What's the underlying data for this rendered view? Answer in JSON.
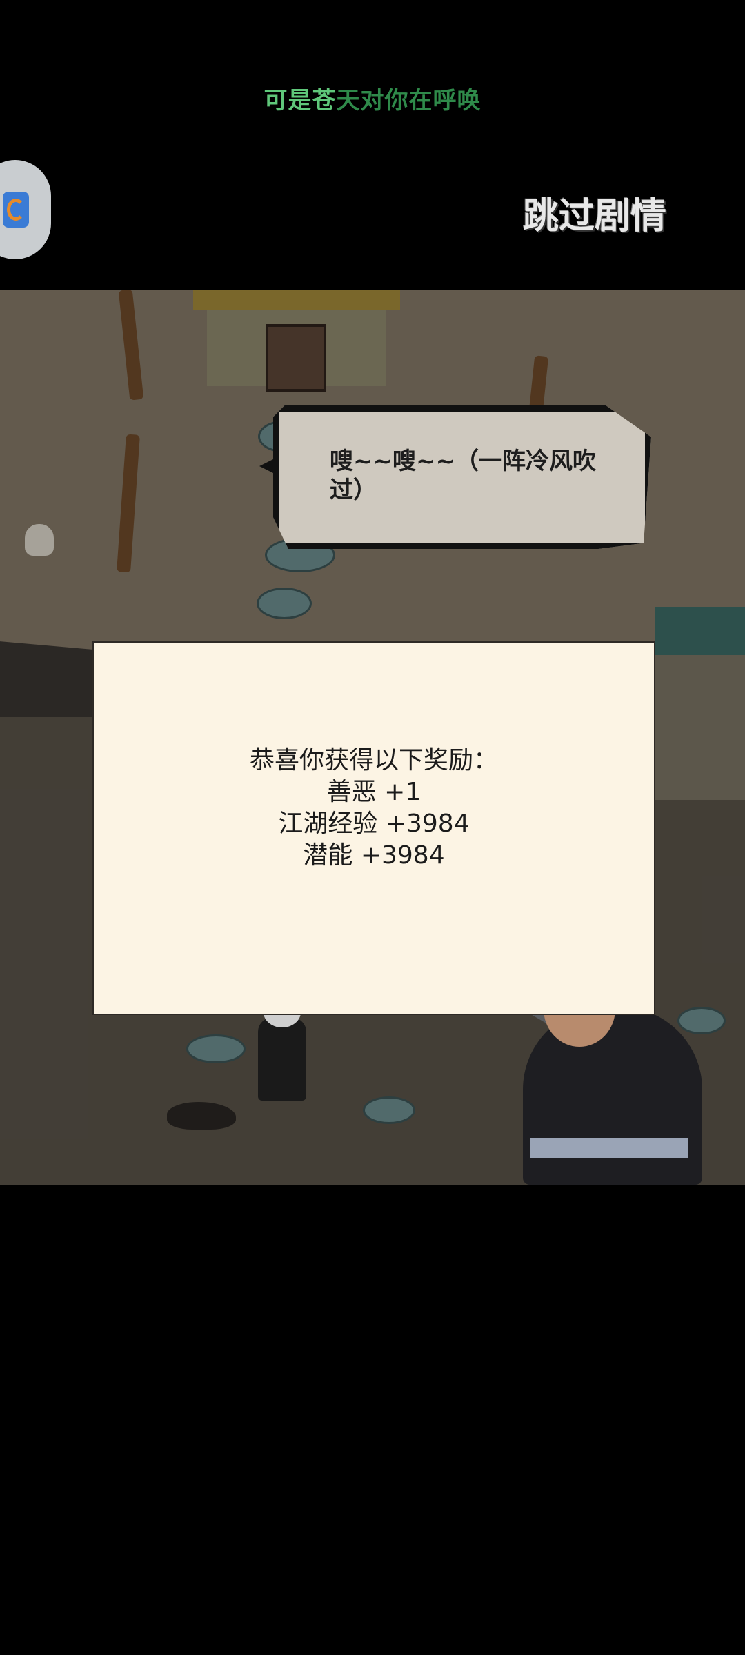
{
  "lyric": {
    "highlighted": "可是苍",
    "rest": "天对你在呼唤"
  },
  "skip_button": {
    "label": "跳过剧情"
  },
  "speech_bubble": {
    "text": "嗖~~嗖~~（一阵冷风吹过）"
  },
  "reward_dialog": {
    "title": "恭喜你获得以下奖励：",
    "items": [
      "善恶 +1",
      "江湖经验 +3984",
      "潜能 +3984"
    ]
  },
  "colors": {
    "lyric_highlight": "#5fc77a",
    "lyric_rest": "#2f8a4a",
    "dialog_bg": "#fcf4e4",
    "scene_ground": "#847867"
  },
  "icons": {
    "floating_ball": "assistant-logo-icon",
    "skull": "skull-icon"
  }
}
